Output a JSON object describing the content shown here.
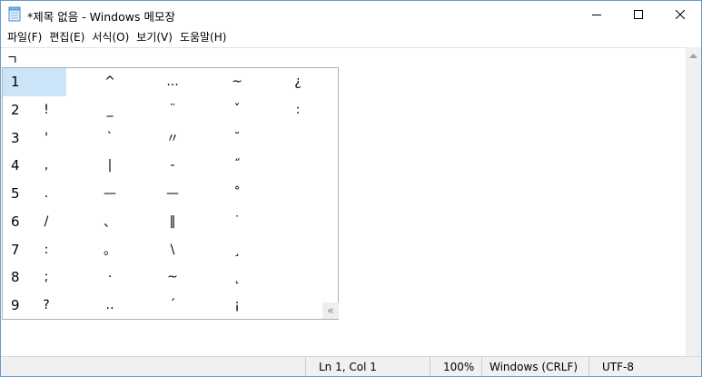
{
  "window": {
    "title": "*제목 없음 - Windows 메모장"
  },
  "icons": {
    "app": "notepad-icon",
    "minimize": "minimize-icon",
    "maximize": "maximize-icon",
    "close": "close-icon"
  },
  "menu": [
    "파일(F)",
    "편집(E)",
    "서식(O)",
    "보기(V)",
    "도움말(H)"
  ],
  "editor": {
    "text": "ㄱ"
  },
  "candidates": {
    "rows": [
      {
        "num": "1",
        "items": [
          "",
          "^",
          "...",
          "~",
          "¿"
        ]
      },
      {
        "num": "2",
        "items": [
          "!",
          "_",
          "¨",
          "ˇ",
          ":"
        ]
      },
      {
        "num": "3",
        "items": [
          "'",
          "`",
          "〃",
          "˘",
          ""
        ]
      },
      {
        "num": "4",
        "items": [
          ",",
          "|",
          "-",
          "˝",
          ""
        ]
      },
      {
        "num": "5",
        "items": [
          ".",
          "—",
          "—",
          "˚",
          ""
        ]
      },
      {
        "num": "6",
        "items": [
          "/",
          "、",
          "‖",
          "˙",
          ""
        ]
      },
      {
        "num": "7",
        "items": [
          ":",
          "。",
          "\\",
          "¸",
          ""
        ]
      },
      {
        "num": "8",
        "items": [
          ";",
          "·",
          "~",
          "˛",
          ""
        ]
      },
      {
        "num": "9",
        "items": [
          "?",
          "‥",
          "´",
          "¡",
          ""
        ]
      }
    ],
    "page_button": "«"
  },
  "statusbar": {
    "position": "Ln 1, Col 1",
    "zoom": "100%",
    "line_ending": "Windows (CRLF)",
    "encoding": "UTF-8"
  }
}
